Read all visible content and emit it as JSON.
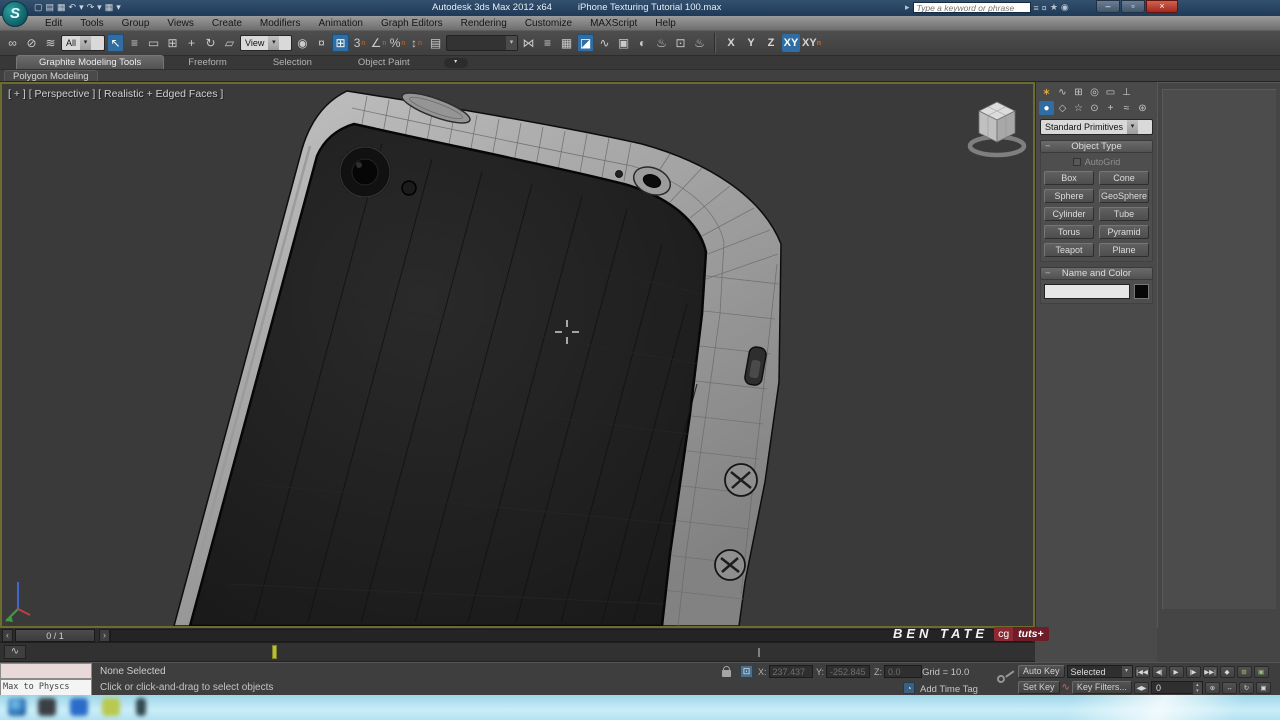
{
  "title_bar": {
    "app_title": "Autodesk 3ds Max 2012 x64",
    "doc_title": "iPhone Texturing Tutorial 100.max",
    "search_placeholder": "Type a keyword or phrase",
    "window": {
      "minimize": "–",
      "maximize": "▫",
      "close": "×"
    }
  },
  "menu_bar": {
    "items": [
      "Edit",
      "Tools",
      "Group",
      "Views",
      "Create",
      "Modifiers",
      "Animation",
      "Graph Editors",
      "Rendering",
      "Customize",
      "MAXScript",
      "Help"
    ]
  },
  "toolbar": {
    "selection_filter": "All",
    "coordinate_system": "View",
    "axis_buttons": [
      "X",
      "Y",
      "Z",
      "XY"
    ],
    "axis_n_suffix": "n"
  },
  "ribbon": {
    "tabs": [
      "Graphite Modeling Tools",
      "Freeform",
      "Selection",
      "Object Paint"
    ],
    "subtab": "Polygon Modeling"
  },
  "viewport": {
    "label": "[ + ] [ Perspective ] [ Realistic + Edged Faces ]",
    "watermark_name": "BEN TATE",
    "watermark_cg": "cg",
    "watermark_tuts": "tuts+"
  },
  "command_panel": {
    "primitives_dropdown": "Standard Primitives",
    "object_type": {
      "header": "Object Type",
      "autogrid": "AutoGrid",
      "buttons": [
        "Box",
        "Cone",
        "Sphere",
        "GeoSphere",
        "Cylinder",
        "Tube",
        "Torus",
        "Pyramid",
        "Teapot",
        "Plane"
      ]
    },
    "name_color_header": "Name and Color"
  },
  "timeline": {
    "slider_label": "0 / 1",
    "prev": "‹",
    "next": "›"
  },
  "status_bar": {
    "listener_text": "Max to Physcs Geom",
    "selection_status": "None Selected",
    "prompt": "Click or click-and-drag to select objects",
    "x_label": "X:",
    "x_value": "237.437",
    "y_label": "Y:",
    "y_value": "-252.845",
    "z_label": "Z:",
    "z_value": "0.0",
    "grid": "Grid = 10.0",
    "add_time_tag": "Add Time Tag"
  },
  "animation": {
    "auto_key": "Auto Key",
    "set_key": "Set Key",
    "key_mode": "Selected",
    "key_filters": "Key Filters...",
    "frame": "0"
  },
  "icons": {
    "qat_new": "▢",
    "qat_open": "▤",
    "qat_save": "▦",
    "undo": "↶",
    "redo": "↷",
    "caret": "▾",
    "search_go": "▸",
    "community": "≡",
    "wrench": "¤",
    "star": "★",
    "help": "◉",
    "link": "∞",
    "unlink": "⊘",
    "bind": "≋",
    "select": "↖",
    "by_name": "≡",
    "region": "▭",
    "crossing": "⊞",
    "move": "+",
    "rotate": "↻",
    "scale": "▱",
    "pivot": "◉",
    "manipulate": "¤",
    "snap3": "3",
    "angle": "∠",
    "percent": "%",
    "spinner": "↕",
    "named_sets": "▤",
    "mirror": "⋈",
    "align": "≡",
    "layers": "▦",
    "graphite": "◪",
    "curve": "∿",
    "schematic": "▣",
    "material": "◐",
    "render_setup": "♨",
    "rfw": "⊡",
    "render": "♨",
    "panel_create": "∗",
    "panel_modify": "∿",
    "panel_hierarchy": "⊞",
    "panel_motion": "◎",
    "panel_display": "▭",
    "panel_utilities": "⊥",
    "cat_geometry": "●",
    "cat_shapes": "◇",
    "cat_lights": "☆",
    "cat_cameras": "⊙",
    "cat_helpers": "+",
    "cat_spacewarps": "≈",
    "cat_systems": "⊛",
    "rollout_collapse": "−",
    "abs_toggle": "⊡",
    "time_tag": "◔",
    "pb_start": "|◀◀",
    "pb_prev": "◀|",
    "pb_play": "▶",
    "pb_next": "|▶",
    "pb_end": "▶▶|",
    "pb_key": "◆",
    "pb_a": "⊞",
    "pb_b": "▣",
    "goto_frame": "◀▶",
    "spin_up": "▴",
    "spin_down": "▾",
    "nav_zoom": "⊕",
    "nav_pan": "↔",
    "nav_orbit": "↻",
    "nav_max": "▣",
    "trackbar_curves": "∿",
    "ribbon_menu": "▾"
  },
  "colors": {
    "accent_blue": "#2f6da3",
    "close_red": "#b8342a",
    "badge_maroon": "#7e1f2d",
    "marker_olive": "#b9bf3c"
  }
}
